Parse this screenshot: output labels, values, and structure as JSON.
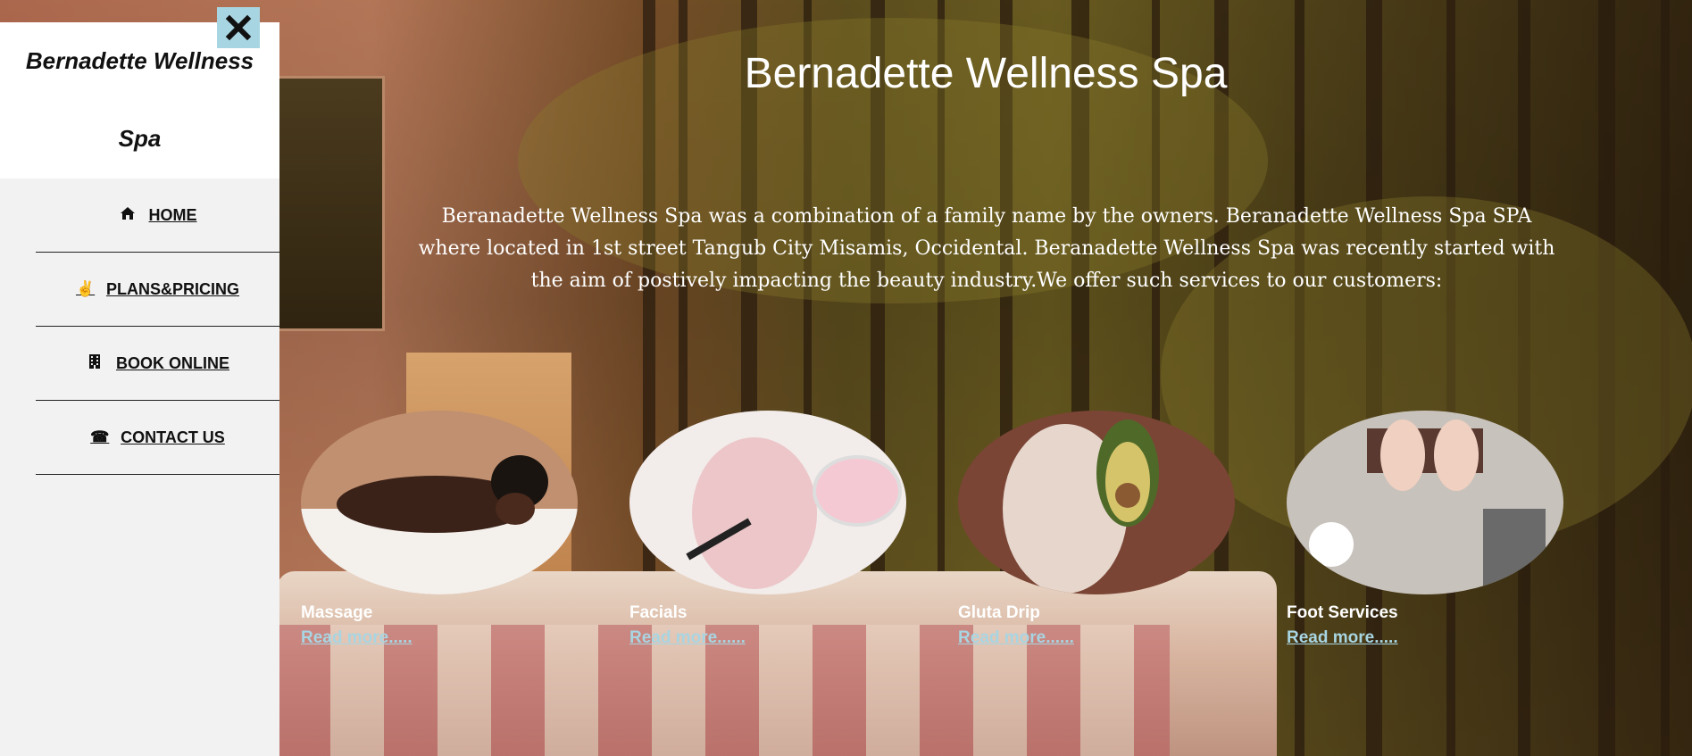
{
  "brand": {
    "name_line1": "Bernadette Wellness",
    "name_line2": "Spa"
  },
  "nav": {
    "items": [
      {
        "label": "HOME",
        "icon": "home-icon",
        "glyph": "⌂"
      },
      {
        "label": "PLANS&PRICING",
        "icon": "peace-hand-icon",
        "glyph": "✌"
      },
      {
        "label": "BOOK ONLINE",
        "icon": "building-icon",
        "glyph": "▦"
      },
      {
        "label": "CONTACT US",
        "icon": "phone-volume-icon",
        "glyph": "☎"
      }
    ]
  },
  "close": {
    "icon": "close-icon"
  },
  "main": {
    "title": "Bernadette Wellness Spa",
    "intro": "Beranadette Wellness Spa was a combination of a family name by the owners. Beranadette Wellness Spa SPA where located in 1st street Tangub City Misamis, Occidental. Beranadette Wellness Spa was recently started with the aim of postively impacting the beauty industry.We offer such services to our customers:",
    "services": [
      {
        "name": "Massage",
        "link": "Read more....."
      },
      {
        "name": "Facials",
        "link": "Read more......"
      },
      {
        "name": "Gluta Drip",
        "link": "Read more......"
      },
      {
        "name": "Foot Services",
        "link": "Read more....."
      }
    ]
  },
  "colors": {
    "sidebar_bg": "#f2f2f2",
    "close_bg": "#a8d5e2",
    "link": "#a8d5e2",
    "heading": "#ffffff"
  }
}
